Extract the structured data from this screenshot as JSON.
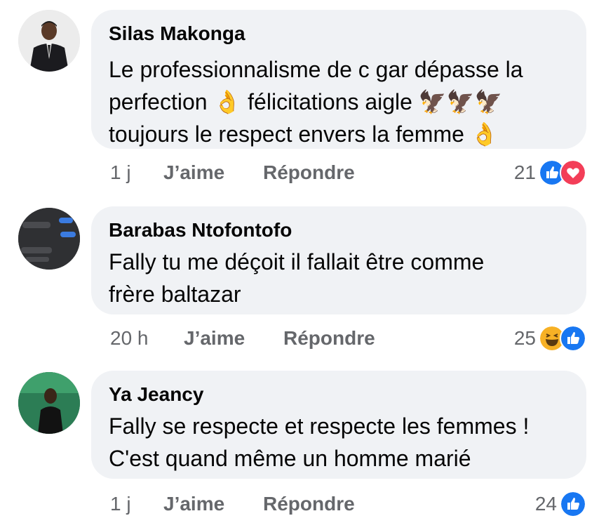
{
  "comments": [
    {
      "author": "Silas Makonga",
      "lines": [
        "Le professionnalisme de c gar dépasse la",
        "perfection 👌 félicitations aigle 🦅🦅🦅",
        "toujours le respect envers la femme 👌"
      ],
      "time": "1 j",
      "like_label": "J’aime",
      "reply_label": "Répondre",
      "reaction_count": "21",
      "reactions": [
        "like-reaction-icon",
        "love-reaction-icon"
      ]
    },
    {
      "author": "Barabas Ntofontofo",
      "lines": [
        "Fally tu me déçoit il fallait être comme",
        "frère baltazar"
      ],
      "time": "20 h",
      "like_label": "J’aime",
      "reply_label": "Répondre",
      "reaction_count": "25",
      "reactions": [
        "haha-reaction-icon",
        "like-reaction-icon"
      ]
    },
    {
      "author": "Ya Jeancy",
      "lines": [
        "Fally se respecte et respecte les femmes !",
        "C'est quand même un homme marié"
      ],
      "time": "1 j",
      "like_label": "J’aime",
      "reply_label": "Répondre",
      "reaction_count": "24",
      "reactions": [
        "like-reaction-icon"
      ]
    }
  ],
  "colors": {
    "bubble": "#f0f2f5",
    "text": "#050505",
    "meta": "#65676b",
    "like_blue": "#1877f2",
    "love_red": "#f33e58",
    "haha_yellow": "#f7b125"
  }
}
